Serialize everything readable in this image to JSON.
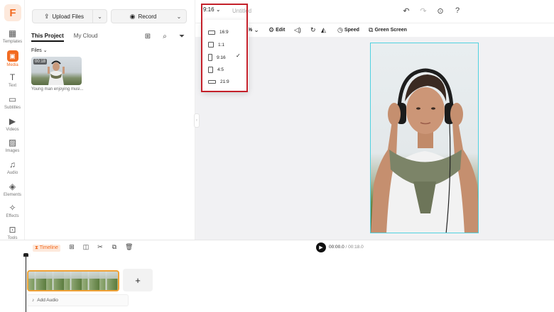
{
  "rail": {
    "logo": "F",
    "items": [
      {
        "label": "Templates",
        "icon": "templates-icon"
      },
      {
        "label": "Media",
        "icon": "media-icon"
      },
      {
        "label": "Text",
        "icon": "text-icon"
      },
      {
        "label": "Subtitles",
        "icon": "subtitles-icon"
      },
      {
        "label": "Videos",
        "icon": "videos-icon"
      },
      {
        "label": "Images",
        "icon": "images-icon"
      },
      {
        "label": "Audio",
        "icon": "audio-icon"
      },
      {
        "label": "Elements",
        "icon": "elements-icon"
      },
      {
        "label": "Effects",
        "icon": "effects-icon"
      },
      {
        "label": "Tools",
        "icon": "tools-icon"
      }
    ],
    "active": "Media"
  },
  "panel": {
    "upload_label": "Upload Files",
    "record_label": "Record",
    "tabs": [
      {
        "label": "This Project"
      },
      {
        "label": "My Cloud"
      }
    ],
    "files_header": "Files",
    "media": {
      "duration": "00:18",
      "caption": "Young man enjoying musi..."
    }
  },
  "header": {
    "ratio": "9:16",
    "title": "Untitled"
  },
  "subtoolbar": {
    "zoom_suffix": "%",
    "edit": "Edit",
    "speed": "Speed",
    "green_screen": "Green Screen"
  },
  "ratio_menu": {
    "options": [
      {
        "label": "16:9"
      },
      {
        "label": "1:1"
      },
      {
        "label": "9:16"
      },
      {
        "label": "4:5"
      },
      {
        "label": "21:9"
      }
    ],
    "selected": "9:16"
  },
  "timeline": {
    "label": "Timeline",
    "current_time": "00:00.0",
    "total_time": "/ 00:18.0",
    "add_audio": "Add Audio",
    "add_clip": "+"
  },
  "colors": {
    "accent": "#f26b21",
    "highlight": "#c4202a",
    "selection": "#4fd1e0",
    "clip_border": "#f0a136"
  }
}
